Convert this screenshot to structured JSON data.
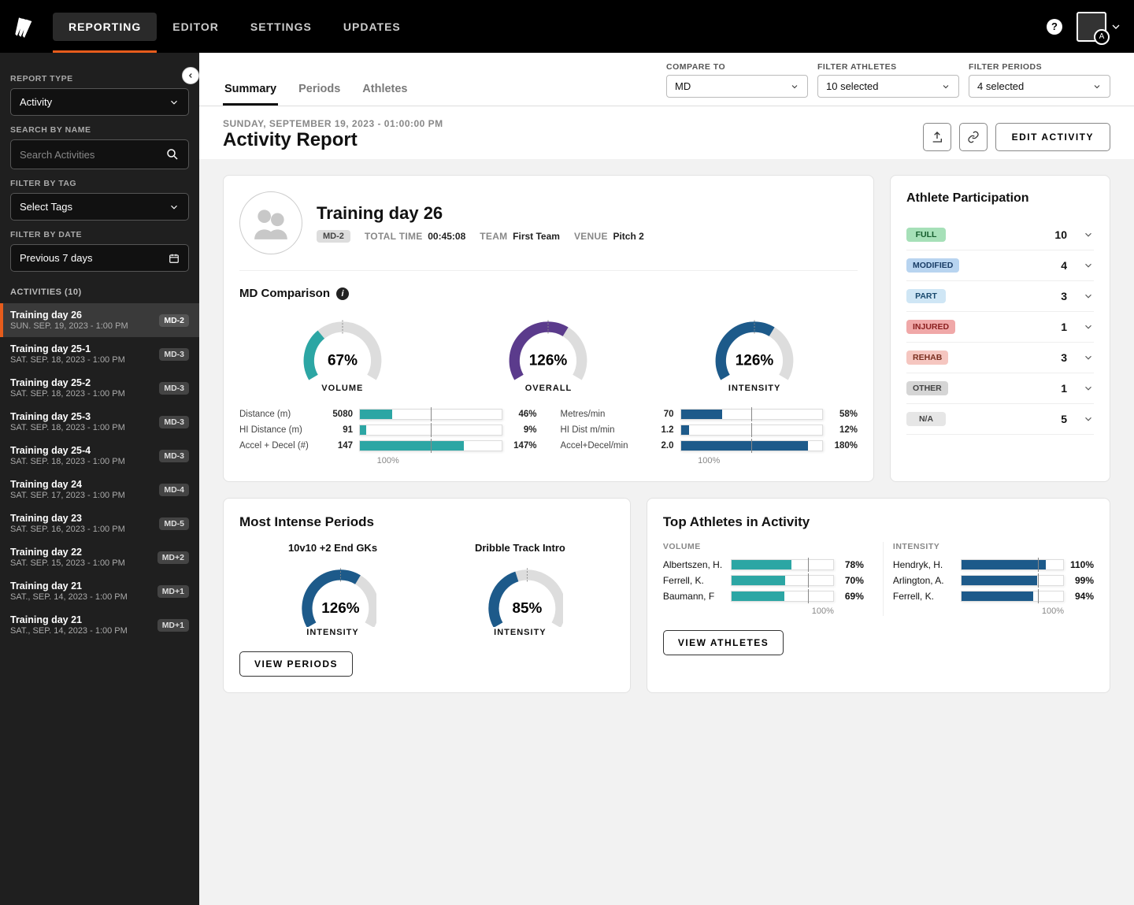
{
  "nav": {
    "tabs": [
      "REPORTING",
      "EDITOR",
      "SETTINGS",
      "UPDATES"
    ],
    "active": 0,
    "avatar_badge": "A"
  },
  "sidebar": {
    "report_type_label": "REPORT TYPE",
    "report_type_value": "Activity",
    "search_label": "SEARCH BY NAME",
    "search_placeholder": "Search Activities",
    "filter_tag_label": "FILTER BY TAG",
    "filter_tag_value": "Select Tags",
    "filter_date_label": "FILTER BY DATE",
    "filter_date_value": "Previous 7 days",
    "activities_header": "ACTIVITIES (10)",
    "activities": [
      {
        "title": "Training day 26",
        "date": "SUN. SEP. 19, 2023 - 1:00 PM",
        "badge": "MD-2",
        "active": true
      },
      {
        "title": "Training day 25-1",
        "date": "SAT. SEP. 18, 2023 - 1:00 PM",
        "badge": "MD-3"
      },
      {
        "title": "Training day 25-2",
        "date": "SAT. SEP. 18, 2023 - 1:00 PM",
        "badge": "MD-3"
      },
      {
        "title": "Training day 25-3",
        "date": "SAT. SEP. 18, 2023 - 1:00 PM",
        "badge": "MD-3"
      },
      {
        "title": "Training day 25-4",
        "date": "SAT. SEP. 18, 2023 - 1:00 PM",
        "badge": "MD-3"
      },
      {
        "title": "Training day 24",
        "date": "SAT. SEP. 17, 2023 - 1:00 PM",
        "badge": "MD-4"
      },
      {
        "title": "Training day 23",
        "date": "SAT. SEP. 16, 2023 - 1:00 PM",
        "badge": "MD-5"
      },
      {
        "title": "Training day 22",
        "date": "SAT. SEP. 15, 2023 - 1:00 PM",
        "badge": "MD+2"
      },
      {
        "title": "Training day 21",
        "date": "SAT., SEP. 14, 2023 - 1:00 PM",
        "badge": "MD+1"
      },
      {
        "title": "Training day 21",
        "date": "SAT., SEP. 14, 2023 - 1:00 PM",
        "badge": "MD+1"
      }
    ]
  },
  "filters": {
    "compare_label": "COMPARE TO",
    "compare_value": "MD",
    "athletes_label": "FILTER ATHLETES",
    "athletes_value": "10 selected",
    "periods_label": "FILTER PERIODS",
    "periods_value": "4 selected"
  },
  "ctabs": [
    "Summary",
    "Periods",
    "Athletes"
  ],
  "ctabs_active": 0,
  "header": {
    "date": "SUNDAY, SEPTEMBER 19, 2023 - 01:00:00 PM",
    "title": "Activity Report",
    "edit_label": "EDIT ACTIVITY"
  },
  "summary": {
    "activity_name": "Training day 26",
    "badge": "MD-2",
    "total_time_label": "TOTAL TIME",
    "total_time_value": "00:45:08",
    "team_label": "TEAM",
    "team_value": "First Team",
    "venue_label": "VENUE",
    "venue_value": "Pitch 2",
    "md_title": "MD Comparison"
  },
  "chart_data": {
    "gauges": [
      {
        "label": "VOLUME",
        "value": 67,
        "color": "#2ca6a4"
      },
      {
        "label": "OVERALL",
        "value": 126,
        "color": "#5b3b8c"
      },
      {
        "label": "INTENSITY",
        "value": 126,
        "color": "#1d5a8a"
      }
    ],
    "metrics_left": [
      {
        "name": "Distance (m)",
        "value": "5080",
        "pct": 46,
        "color": "#2ca6a4"
      },
      {
        "name": "HI Distance (m)",
        "value": "91",
        "pct": 9,
        "color": "#2ca6a4"
      },
      {
        "name": "Accel + Decel (#)",
        "value": "147",
        "pct": 147,
        "color": "#2ca6a4"
      }
    ],
    "metrics_right": [
      {
        "name": "Metres/min",
        "value": "70",
        "pct": 58,
        "color": "#1d5a8a"
      },
      {
        "name": "HI Dist m/min",
        "value": "1.2",
        "pct": 12,
        "color": "#1d5a8a"
      },
      {
        "name": "Accel+Decel/min",
        "value": "2.0",
        "pct": 180,
        "color": "#1d5a8a"
      }
    ],
    "hundred_label": "100%",
    "top_periods": [
      {
        "name": "10v10 +2 End GKs",
        "value": 126,
        "label": "INTENSITY",
        "color": "#1d5a8a"
      },
      {
        "name": "Dribble Track Intro",
        "value": 85,
        "label": "INTENSITY",
        "color": "#1d5a8a"
      }
    ],
    "top_athletes": {
      "volume_label": "VOLUME",
      "intensity_label": "INTENSITY",
      "volume": [
        {
          "name": "Albertszen, H.",
          "pct": 78
        },
        {
          "name": "Ferrell, K.",
          "pct": 70
        },
        {
          "name": "Baumann, F",
          "pct": 69
        }
      ],
      "intensity": [
        {
          "name": "Hendryk, H.",
          "pct": 110
        },
        {
          "name": "Arlington, A.",
          "pct": 99
        },
        {
          "name": "Ferrell, K.",
          "pct": 94
        }
      ],
      "hundred": "100%"
    }
  },
  "participation": {
    "title": "Athlete Participation",
    "rows": [
      {
        "label": "FULL",
        "count": 10,
        "bg": "#a6e0b8",
        "fg": "#145c2c"
      },
      {
        "label": "MODIFIED",
        "count": 4,
        "bg": "#b8d4f0",
        "fg": "#1a3d66"
      },
      {
        "label": "PART",
        "count": 3,
        "bg": "#cfe6f5",
        "fg": "#1a4a6e"
      },
      {
        "label": "INJURED",
        "count": 1,
        "bg": "#f0a8a8",
        "fg": "#8a1f1f"
      },
      {
        "label": "REHAB",
        "count": 3,
        "bg": "#f5c6c0",
        "fg": "#7a3020"
      },
      {
        "label": "OTHER",
        "count": 1,
        "bg": "#d5d5d5",
        "fg": "#444"
      },
      {
        "label": "N/A",
        "count": 5,
        "bg": "#e6e6e6",
        "fg": "#444"
      }
    ]
  },
  "periods_btn": "VIEW PERIODS",
  "athletes_btn": "VIEW ATHLETES",
  "periods_title": "Most Intense Periods",
  "athletes_title": "Top Athletes in Activity"
}
